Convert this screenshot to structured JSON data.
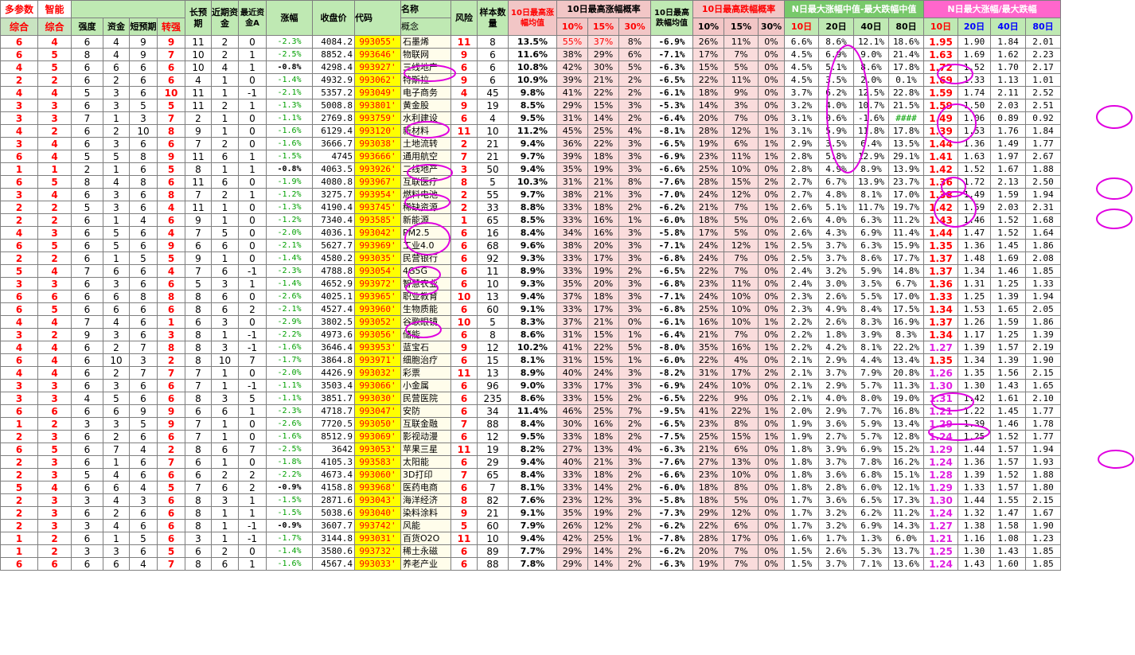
{
  "header": {
    "r1": {
      "zonghe_title": "多参数",
      "zhineng_title": "智能",
      "changyuqi": "长预期",
      "jinqi_zijin": "近期资金",
      "zuijin_zijinA": "最近资金A",
      "zhangfu": "涨幅",
      "shoupanjia": "收盘价",
      "daima": "代码",
      "mingcheng": "名称",
      "fengxian": "风险",
      "yangben": "样本数量",
      "avg10_title": "10日最高涨幅均值",
      "prob_up_title": "10日最高涨幅概率",
      "avg_down_title": "10日最高跌幅均值",
      "prob_down_title": "10日最高跌幅概率",
      "median_title": "N日最大涨幅中值-最大跌幅中值",
      "ratio_title": "N日最大涨幅/最大跌幅"
    },
    "r2": {
      "zonghe1": "综合",
      "zonghe2": "综合",
      "qiangdu": "强度",
      "zijin": "资金",
      "duanyuqi": "短预期",
      "zhuanqiang": "转强",
      "gainian": "概念",
      "p10": "10%",
      "p15": "15%",
      "p30": "30%",
      "d10": "10%",
      "d15": "15%",
      "d30": "30%",
      "m10": "10日",
      "m20": "20日",
      "m40": "40日",
      "m80": "80日",
      "r10": "10日",
      "r20": "20日",
      "r40": "40日",
      "r80": "80日"
    }
  },
  "rows": [
    [
      "6",
      "4",
      "6",
      "4",
      "9",
      "9",
      "11",
      "2",
      "0",
      "-2.3%",
      "4084.2",
      "993055'",
      "石墨烯",
      "11",
      "8",
      "13.5%",
      "55%",
      "37%",
      "8%",
      "-6.9%",
      "26%",
      "11%",
      "0%",
      "6.6%",
      "8.6%",
      "12.1%",
      "18.6%",
      "1.95",
      "1.90",
      "1.84",
      "2.01"
    ],
    [
      "6",
      "5",
      "8",
      "4",
      "9",
      "7",
      "10",
      "2",
      "1",
      "-2.5%",
      "8852.4",
      "993646'",
      "物联网",
      "9",
      "6",
      "11.6%",
      "38%",
      "29%",
      "6%",
      "-7.1%",
      "17%",
      "7%",
      "0%",
      "4.5%",
      "6.9%",
      "9.0%",
      "21.4%",
      "1.63",
      "1.69",
      "1.62",
      "2.23"
    ],
    [
      "4",
      "5",
      "6",
      "6",
      "6",
      "6",
      "10",
      "4",
      "1",
      "-0.8%",
      "4298.4",
      "993927'",
      "三线地产",
      "6",
      "6",
      "10.8%",
      "42%",
      "30%",
      "5%",
      "-6.3%",
      "15%",
      "5%",
      "0%",
      "4.5%",
      "5.1%",
      "8.6%",
      "17.8%",
      "1.72",
      "1.52",
      "1.70",
      "2.17"
    ],
    [
      "2",
      "2",
      "6",
      "2",
      "6",
      "6",
      "4",
      "1",
      "0",
      "-1.4%",
      "4932.9",
      "993062'",
      "特斯拉",
      "9",
      "6",
      "10.9%",
      "39%",
      "21%",
      "2%",
      "-6.5%",
      "22%",
      "11%",
      "0%",
      "4.5%",
      "3.5%",
      "2.0%",
      "0.1%",
      "1.69",
      "1.33",
      "1.13",
      "1.01"
    ],
    [
      "4",
      "4",
      "5",
      "3",
      "6",
      "10",
      "11",
      "1",
      "-1",
      "-2.1%",
      "5357.2",
      "993049'",
      "电子商务",
      "4",
      "45",
      "9.8%",
      "41%",
      "22%",
      "2%",
      "-6.1%",
      "18%",
      "9%",
      "0%",
      "3.7%",
      "6.2%",
      "12.5%",
      "22.8%",
      "1.59",
      "1.74",
      "2.11",
      "2.52"
    ],
    [
      "3",
      "3",
      "6",
      "3",
      "5",
      "5",
      "11",
      "2",
      "1",
      "-1.3%",
      "5008.8",
      "993801'",
      "黄金股",
      "9",
      "19",
      "8.5%",
      "29%",
      "15%",
      "3%",
      "-5.3%",
      "14%",
      "3%",
      "0%",
      "3.2%",
      "4.0%",
      "10.7%",
      "21.5%",
      "1.59",
      "1.50",
      "2.03",
      "2.51"
    ],
    [
      "3",
      "3",
      "7",
      "1",
      "3",
      "7",
      "2",
      "1",
      "0",
      "-1.1%",
      "2769.8",
      "993759'",
      "水利建设",
      "6",
      "4",
      "9.5%",
      "31%",
      "14%",
      "2%",
      "-6.4%",
      "20%",
      "7%",
      "0%",
      "3.1%",
      "0.6%",
      "-1.6%",
      "####",
      "1.49",
      "1.06",
      "0.89",
      "0.92"
    ],
    [
      "4",
      "2",
      "6",
      "2",
      "10",
      "8",
      "9",
      "1",
      "0",
      "-1.6%",
      "6129.4",
      "993120'",
      "新材料",
      "11",
      "10",
      "11.2%",
      "45%",
      "25%",
      "4%",
      "-8.1%",
      "28%",
      "12%",
      "1%",
      "3.1%",
      "5.9%",
      "11.8%",
      "17.8%",
      "1.39",
      "1.53",
      "1.76",
      "1.84"
    ],
    [
      "3",
      "4",
      "6",
      "3",
      "6",
      "6",
      "7",
      "2",
      "0",
      "-1.6%",
      "3666.7",
      "993038'",
      "土地流转",
      "2",
      "21",
      "9.4%",
      "36%",
      "22%",
      "3%",
      "-6.5%",
      "19%",
      "6%",
      "1%",
      "2.9%",
      "3.5%",
      "6.4%",
      "13.5%",
      "1.44",
      "1.36",
      "1.49",
      "1.77"
    ],
    [
      "6",
      "4",
      "5",
      "5",
      "8",
      "9",
      "11",
      "6",
      "1",
      "-1.5%",
      "4745",
      "993666'",
      "通用航空",
      "7",
      "21",
      "9.7%",
      "39%",
      "18%",
      "3%",
      "-6.9%",
      "23%",
      "11%",
      "1%",
      "2.8%",
      "5.8%",
      "12.9%",
      "29.1%",
      "1.41",
      "1.63",
      "1.97",
      "2.67"
    ],
    [
      "1",
      "1",
      "2",
      "1",
      "6",
      "5",
      "8",
      "1",
      "1",
      "-0.8%",
      "4063.5",
      "993926'",
      "二线地产",
      "3",
      "50",
      "9.4%",
      "35%",
      "19%",
      "3%",
      "-6.6%",
      "25%",
      "10%",
      "0%",
      "2.8%",
      "4.9%",
      "8.9%",
      "13.9%",
      "1.42",
      "1.52",
      "1.67",
      "1.88"
    ],
    [
      "6",
      "5",
      "8",
      "4",
      "8",
      "6",
      "11",
      "6",
      "0",
      "-1.9%",
      "4080.8",
      "993967'",
      "互联医疗",
      "8",
      "5",
      "10.3%",
      "31%",
      "21%",
      "8%",
      "-7.6%",
      "28%",
      "15%",
      "2%",
      "2.7%",
      "6.7%",
      "13.9%",
      "23.7%",
      "1.36",
      "1.72",
      "2.13",
      "2.50"
    ],
    [
      "3",
      "4",
      "6",
      "3",
      "6",
      "8",
      "7",
      "2",
      "1",
      "-1.2%",
      "3275.7",
      "993954'",
      "燃料电池",
      "2",
      "55",
      "9.7%",
      "38%",
      "21%",
      "3%",
      "-7.0%",
      "24%",
      "12%",
      "0%",
      "2.7%",
      "4.8%",
      "8.1%",
      "17.0%",
      "1.38",
      "1.49",
      "1.59",
      "1.94"
    ],
    [
      "2",
      "2",
      "5",
      "3",
      "6",
      "4",
      "11",
      "1",
      "0",
      "-1.3%",
      "4190.4",
      "993745'",
      "稀缺资源",
      "2",
      "33",
      "8.8%",
      "33%",
      "18%",
      "2%",
      "-6.2%",
      "21%",
      "7%",
      "1%",
      "2.6%",
      "5.1%",
      "11.7%",
      "19.7%",
      "1.42",
      "1.59",
      "2.03",
      "2.31"
    ],
    [
      "2",
      "2",
      "6",
      "1",
      "4",
      "6",
      "9",
      "1",
      "0",
      "-1.2%",
      "7340.4",
      "993585'",
      "新能源",
      "1",
      "65",
      "8.5%",
      "33%",
      "16%",
      "1%",
      "-6.0%",
      "18%",
      "5%",
      "0%",
      "2.6%",
      "4.0%",
      "6.3%",
      "11.2%",
      "1.43",
      "1.46",
      "1.52",
      "1.68"
    ],
    [
      "4",
      "3",
      "6",
      "5",
      "6",
      "4",
      "7",
      "5",
      "0",
      "-2.0%",
      "4036.1",
      "993042'",
      "PM2.5",
      "6",
      "16",
      "8.4%",
      "34%",
      "16%",
      "3%",
      "-5.8%",
      "17%",
      "5%",
      "0%",
      "2.6%",
      "4.3%",
      "6.9%",
      "11.4%",
      "1.44",
      "1.47",
      "1.52",
      "1.64"
    ],
    [
      "6",
      "5",
      "6",
      "5",
      "6",
      "9",
      "6",
      "6",
      "0",
      "-2.1%",
      "5627.7",
      "993969'",
      "工业4.0",
      "6",
      "68",
      "9.6%",
      "38%",
      "20%",
      "3%",
      "-7.1%",
      "24%",
      "12%",
      "1%",
      "2.5%",
      "3.7%",
      "6.3%",
      "15.9%",
      "1.35",
      "1.36",
      "1.45",
      "1.86"
    ],
    [
      "2",
      "2",
      "6",
      "1",
      "5",
      "5",
      "9",
      "1",
      "0",
      "-1.4%",
      "4580.2",
      "993035'",
      "民营银行",
      "6",
      "92",
      "9.3%",
      "33%",
      "17%",
      "3%",
      "-6.8%",
      "24%",
      "7%",
      "0%",
      "2.5%",
      "3.7%",
      "8.6%",
      "17.7%",
      "1.37",
      "1.48",
      "1.69",
      "2.08"
    ],
    [
      "5",
      "4",
      "7",
      "6",
      "6",
      "4",
      "7",
      "6",
      "-1",
      "-2.3%",
      "4788.8",
      "993054'",
      "4G5G",
      "6",
      "11",
      "8.9%",
      "33%",
      "19%",
      "2%",
      "-6.5%",
      "22%",
      "7%",
      "0%",
      "2.4%",
      "3.2%",
      "5.9%",
      "14.8%",
      "1.37",
      "1.34",
      "1.46",
      "1.85"
    ],
    [
      "3",
      "3",
      "6",
      "3",
      "6",
      "6",
      "5",
      "3",
      "1",
      "-1.4%",
      "4652.9",
      "993972'",
      "智慧农业",
      "6",
      "10",
      "9.3%",
      "35%",
      "20%",
      "3%",
      "-6.8%",
      "23%",
      "11%",
      "0%",
      "2.4%",
      "3.0%",
      "3.5%",
      "6.7%",
      "1.36",
      "1.31",
      "1.25",
      "1.33"
    ],
    [
      "6",
      "6",
      "6",
      "6",
      "8",
      "8",
      "8",
      "6",
      "0",
      "-2.6%",
      "4025.1",
      "993965'",
      "职业教育",
      "10",
      "13",
      "9.4%",
      "37%",
      "18%",
      "3%",
      "-7.1%",
      "24%",
      "10%",
      "0%",
      "2.3%",
      "2.6%",
      "5.5%",
      "17.0%",
      "1.33",
      "1.25",
      "1.39",
      "1.94"
    ],
    [
      "6",
      "5",
      "6",
      "6",
      "6",
      "6",
      "8",
      "6",
      "2",
      "-2.1%",
      "4527.4",
      "993960'",
      "生物质能",
      "6",
      "60",
      "9.1%",
      "33%",
      "17%",
      "3%",
      "-6.8%",
      "25%",
      "10%",
      "0%",
      "2.3%",
      "4.9%",
      "8.4%",
      "17.5%",
      "1.34",
      "1.53",
      "1.65",
      "2.05"
    ],
    [
      "4",
      "4",
      "7",
      "4",
      "6",
      "1",
      "6",
      "3",
      "0",
      "-2.9%",
      "3802.5",
      "993052'",
      "谷歌眼镜",
      "10",
      "5",
      "8.3%",
      "37%",
      "21%",
      "0%",
      "-6.1%",
      "16%",
      "10%",
      "1%",
      "2.2%",
      "2.6%",
      "8.3%",
      "16.9%",
      "1.37",
      "1.26",
      "1.59",
      "1.86"
    ],
    [
      "3",
      "2",
      "9",
      "3",
      "6",
      "3",
      "8",
      "1",
      "-1",
      "-2.2%",
      "4973.6",
      "993056'",
      "储能",
      "6",
      "8",
      "8.6%",
      "31%",
      "15%",
      "1%",
      "-6.4%",
      "21%",
      "7%",
      "0%",
      "2.2%",
      "1.8%",
      "3.9%",
      "8.3%",
      "1.34",
      "1.17",
      "1.25",
      "1.39"
    ],
    [
      "4",
      "4",
      "6",
      "2",
      "7",
      "8",
      "8",
      "3",
      "-1",
      "-1.6%",
      "3646.4",
      "993953'",
      "蓝宝石",
      "9",
      "12",
      "10.2%",
      "41%",
      "22%",
      "5%",
      "-8.0%",
      "35%",
      "16%",
      "1%",
      "2.2%",
      "4.2%",
      "8.1%",
      "22.2%",
      "1.27",
      "1.39",
      "1.57",
      "2.19"
    ],
    [
      "6",
      "4",
      "6",
      "10",
      "3",
      "2",
      "8",
      "10",
      "7",
      "-1.7%",
      "3864.8",
      "993971'",
      "细胞治疗",
      "6",
      "15",
      "8.1%",
      "31%",
      "15%",
      "1%",
      "-6.0%",
      "22%",
      "4%",
      "0%",
      "2.1%",
      "2.9%",
      "4.4%",
      "13.4%",
      "1.35",
      "1.34",
      "1.39",
      "1.90"
    ],
    [
      "4",
      "4",
      "6",
      "2",
      "7",
      "7",
      "7",
      "1",
      "0",
      "-2.0%",
      "4426.9",
      "993032'",
      "彩票",
      "11",
      "13",
      "8.9%",
      "40%",
      "24%",
      "3%",
      "-8.2%",
      "31%",
      "17%",
      "2%",
      "2.1%",
      "3.7%",
      "7.9%",
      "20.8%",
      "1.26",
      "1.35",
      "1.56",
      "2.15"
    ],
    [
      "3",
      "3",
      "6",
      "3",
      "6",
      "6",
      "7",
      "1",
      "-1",
      "-1.1%",
      "3503.4",
      "993066'",
      "小金属",
      "6",
      "96",
      "9.0%",
      "33%",
      "17%",
      "3%",
      "-6.9%",
      "24%",
      "10%",
      "0%",
      "2.1%",
      "2.9%",
      "5.7%",
      "11.3%",
      "1.30",
      "1.30",
      "1.43",
      "1.65"
    ],
    [
      "3",
      "3",
      "4",
      "5",
      "6",
      "6",
      "8",
      "3",
      "5",
      "-1.1%",
      "3851.7",
      "993030'",
      "民营医院",
      "6",
      "235",
      "8.6%",
      "33%",
      "15%",
      "2%",
      "-6.5%",
      "22%",
      "9%",
      "0%",
      "2.1%",
      "4.0%",
      "8.0%",
      "19.0%",
      "1.31",
      "1.42",
      "1.61",
      "2.10"
    ],
    [
      "6",
      "6",
      "6",
      "6",
      "9",
      "9",
      "6",
      "6",
      "1",
      "-2.3%",
      "4718.7",
      "993047'",
      "安防",
      "6",
      "34",
      "11.4%",
      "46%",
      "25%",
      "7%",
      "-9.5%",
      "41%",
      "22%",
      "1%",
      "2.0%",
      "2.9%",
      "7.7%",
      "16.8%",
      "1.21",
      "1.22",
      "1.45",
      "1.77"
    ],
    [
      "1",
      "2",
      "3",
      "3",
      "5",
      "9",
      "7",
      "1",
      "0",
      "-2.6%",
      "7720.5",
      "993050'",
      "互联金融",
      "7",
      "88",
      "8.4%",
      "30%",
      "16%",
      "2%",
      "-6.5%",
      "23%",
      "8%",
      "0%",
      "1.9%",
      "3.6%",
      "5.9%",
      "13.4%",
      "1.29",
      "1.39",
      "1.46",
      "1.78"
    ],
    [
      "2",
      "3",
      "6",
      "2",
      "6",
      "6",
      "7",
      "1",
      "0",
      "-1.6%",
      "8512.9",
      "993069'",
      "影视动漫",
      "6",
      "12",
      "9.5%",
      "33%",
      "18%",
      "2%",
      "-7.5%",
      "25%",
      "15%",
      "1%",
      "1.9%",
      "2.7%",
      "5.7%",
      "12.8%",
      "1.24",
      "1.25",
      "1.52",
      "1.77"
    ],
    [
      "6",
      "5",
      "6",
      "7",
      "4",
      "2",
      "8",
      "6",
      "7",
      "-2.5%",
      "3642",
      "993053'",
      "苹果三星",
      "11",
      "19",
      "8.2%",
      "27%",
      "13%",
      "4%",
      "-6.3%",
      "21%",
      "6%",
      "0%",
      "1.8%",
      "3.9%",
      "6.9%",
      "15.2%",
      "1.29",
      "1.44",
      "1.57",
      "1.94"
    ],
    [
      "2",
      "3",
      "6",
      "1",
      "6",
      "7",
      "6",
      "1",
      "0",
      "-1.8%",
      "4105.3",
      "993583'",
      "太阳能",
      "6",
      "29",
      "9.4%",
      "40%",
      "21%",
      "3%",
      "-7.6%",
      "27%",
      "13%",
      "0%",
      "1.8%",
      "3.7%",
      "7.8%",
      "16.2%",
      "1.24",
      "1.36",
      "1.57",
      "1.93"
    ],
    [
      "2",
      "3",
      "5",
      "4",
      "6",
      "6",
      "6",
      "2",
      "2",
      "-2.2%",
      "4673.4",
      "993060'",
      "3D打印",
      "7",
      "65",
      "8.4%",
      "33%",
      "18%",
      "2%",
      "-6.6%",
      "23%",
      "10%",
      "0%",
      "1.8%",
      "3.6%",
      "6.8%",
      "15.1%",
      "1.28",
      "1.39",
      "1.52",
      "1.88"
    ],
    [
      "5",
      "4",
      "6",
      "6",
      "4",
      "5",
      "7",
      "6",
      "2",
      "-0.9%",
      "4158.8",
      "993968'",
      "医药电商",
      "6",
      "7",
      "8.1%",
      "33%",
      "14%",
      "2%",
      "-6.0%",
      "18%",
      "8%",
      "0%",
      "1.8%",
      "2.8%",
      "6.0%",
      "12.1%",
      "1.29",
      "1.33",
      "1.57",
      "1.80"
    ],
    [
      "2",
      "3",
      "3",
      "4",
      "3",
      "6",
      "8",
      "3",
      "1",
      "-1.5%",
      "2871.6",
      "993043'",
      "海洋经济",
      "8",
      "82",
      "7.6%",
      "23%",
      "12%",
      "3%",
      "-5.8%",
      "18%",
      "5%",
      "0%",
      "1.7%",
      "3.6%",
      "6.5%",
      "17.3%",
      "1.30",
      "1.44",
      "1.55",
      "2.15"
    ],
    [
      "2",
      "3",
      "6",
      "2",
      "6",
      "6",
      "8",
      "1",
      "1",
      "-1.5%",
      "5038.6",
      "993040'",
      "染料涂料",
      "9",
      "21",
      "9.1%",
      "35%",
      "19%",
      "2%",
      "-7.3%",
      "29%",
      "12%",
      "0%",
      "1.7%",
      "3.2%",
      "6.2%",
      "11.2%",
      "1.24",
      "1.32",
      "1.47",
      "1.67"
    ],
    [
      "2",
      "3",
      "3",
      "4",
      "6",
      "6",
      "8",
      "1",
      "-1",
      "-0.9%",
      "3607.7",
      "993742'",
      "风能",
      "5",
      "60",
      "7.9%",
      "26%",
      "12%",
      "2%",
      "-6.2%",
      "22%",
      "6%",
      "0%",
      "1.7%",
      "3.2%",
      "6.9%",
      "14.3%",
      "1.27",
      "1.38",
      "1.58",
      "1.90"
    ],
    [
      "1",
      "2",
      "6",
      "1",
      "5",
      "6",
      "3",
      "1",
      "-1",
      "-1.7%",
      "3144.8",
      "993031'",
      "百货O2O",
      "11",
      "10",
      "9.4%",
      "42%",
      "25%",
      "1%",
      "-7.8%",
      "28%",
      "17%",
      "0%",
      "1.6%",
      "1.7%",
      "1.3%",
      "6.0%",
      "1.21",
      "1.16",
      "1.08",
      "1.23"
    ],
    [
      "1",
      "2",
      "3",
      "3",
      "6",
      "5",
      "6",
      "2",
      "0",
      "-1.4%",
      "3580.6",
      "993732'",
      "稀土永磁",
      "6",
      "89",
      "7.7%",
      "29%",
      "14%",
      "2%",
      "-6.2%",
      "20%",
      "7%",
      "0%",
      "1.5%",
      "2.6%",
      "5.3%",
      "13.7%",
      "1.25",
      "1.30",
      "1.43",
      "1.85"
    ],
    [
      "6",
      "6",
      "6",
      "6",
      "4",
      "7",
      "8",
      "6",
      "1",
      "-1.6%",
      "4567.4",
      "993033'",
      "养老产业",
      "6",
      "88",
      "7.8%",
      "29%",
      "14%",
      "2%",
      "-6.3%",
      "19%",
      "7%",
      "0%",
      "1.5%",
      "3.7%",
      "7.1%",
      "13.6%",
      "1.24",
      "1.43",
      "1.60",
      "1.85"
    ]
  ],
  "colors": {
    "green_header": "#bfe9b3",
    "pink_header": "#f2c6c6",
    "yellow_code": "#ffff00",
    "red_text": "#ff0000",
    "magenta_text": "#e020e0",
    "blue_text": "#0000ff",
    "annotation_magenta": "#e000e0"
  }
}
